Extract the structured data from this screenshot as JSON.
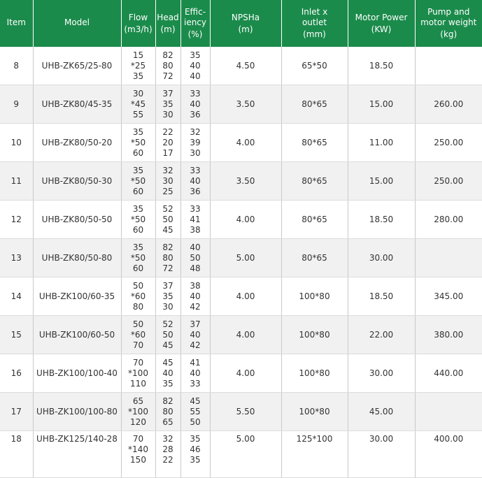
{
  "columns": [
    {
      "label": "Item",
      "sub": ""
    },
    {
      "label": "Model",
      "sub": ""
    },
    {
      "label": "Flow",
      "sub": "(m3/h)"
    },
    {
      "label": "Head",
      "sub": "(m)"
    },
    {
      "label": "Effic-\niency",
      "sub": "(%)"
    },
    {
      "label": "NPSHa",
      "sub": "(m)"
    },
    {
      "label": "Inlet x\noutlet",
      "sub": "(mm)"
    },
    {
      "label": "Motor Power",
      "sub": "(KW)"
    },
    {
      "label": "Pump and\nmotor weight",
      "sub": "(kg)"
    }
  ],
  "rows": [
    {
      "item": "8",
      "model": "UHB-ZK65/25-80",
      "flow": [
        "15",
        "*25",
        "35"
      ],
      "head": [
        "82",
        "80",
        "72"
      ],
      "eff": [
        "35",
        "40",
        "40"
      ],
      "npsha": "4.50",
      "inlet": "65*50",
      "power": "18.50",
      "weight": ""
    },
    {
      "item": "9",
      "model": "UHB-ZK80/45-35",
      "flow": [
        "30",
        "*45",
        "55"
      ],
      "head": [
        "37",
        "35",
        "30"
      ],
      "eff": [
        "33",
        "40",
        "36"
      ],
      "npsha": "3.50",
      "inlet": "80*65",
      "power": "15.00",
      "weight": "260.00"
    },
    {
      "item": "10",
      "model": "UHB-ZK80/50-20",
      "flow": [
        "35",
        "*50",
        "60"
      ],
      "head": [
        "22",
        "20",
        "17"
      ],
      "eff": [
        "32",
        "39",
        "30"
      ],
      "npsha": "4.00",
      "inlet": "80*65",
      "power": "11.00",
      "weight": "250.00"
    },
    {
      "item": "11",
      "model": "UHB-ZK80/50-30",
      "flow": [
        "35",
        "*50",
        "60"
      ],
      "head": [
        "32",
        "30",
        "25"
      ],
      "eff": [
        "33",
        "40",
        "36"
      ],
      "npsha": "3.50",
      "inlet": "80*65",
      "power": "15.00",
      "weight": "250.00"
    },
    {
      "item": "12",
      "model": "UHB-ZK80/50-50",
      "flow": [
        "35",
        "*50",
        "60"
      ],
      "head": [
        "52",
        "50",
        "45"
      ],
      "eff": [
        "33",
        "41",
        "38"
      ],
      "npsha": "4.00",
      "inlet": "80*65",
      "power": "18.50",
      "weight": "280.00"
    },
    {
      "item": "13",
      "model": "UHB-ZK80/50-80",
      "flow": [
        "35",
        "*50",
        "60"
      ],
      "head": [
        "82",
        "80",
        "72"
      ],
      "eff": [
        "40",
        "50",
        "48"
      ],
      "npsha": "5.00",
      "inlet": "80*65",
      "power": "30.00",
      "weight": ""
    },
    {
      "item": "14",
      "model": "UHB-ZK100/60-35",
      "flow": [
        "50",
        "*60",
        "80"
      ],
      "head": [
        "37",
        "35",
        "30"
      ],
      "eff": [
        "38",
        "40",
        "42"
      ],
      "npsha": "4.00",
      "inlet": "100*80",
      "power": "18.50",
      "weight": "345.00"
    },
    {
      "item": "15",
      "model": "UHB-ZK100/60-50",
      "flow": [
        "50",
        "*60",
        "70"
      ],
      "head": [
        "52",
        "50",
        "45"
      ],
      "eff": [
        "37",
        "40",
        "42"
      ],
      "npsha": "4.00",
      "inlet": "100*80",
      "power": "22.00",
      "weight": "380.00"
    },
    {
      "item": "16",
      "model": "UHB-ZK100/100-40",
      "flow": [
        "70",
        "*100",
        "110"
      ],
      "head": [
        "45",
        "40",
        "35"
      ],
      "eff": [
        "41",
        "40",
        "33"
      ],
      "npsha": "4.00",
      "inlet": "100*80",
      "power": "30.00",
      "weight": "440.00"
    },
    {
      "item": "17",
      "model": "UHB-ZK100/100-80",
      "flow": [
        "65",
        "*100",
        "120"
      ],
      "head": [
        "82",
        "80",
        "65"
      ],
      "eff": [
        "45",
        "55",
        "50"
      ],
      "npsha": "5.50",
      "inlet": "100*80",
      "power": "45.00",
      "weight": ""
    },
    {
      "item": "18",
      "model": "UHB-ZK125/140-28",
      "flow": [
        "70",
        "*140",
        "150"
      ],
      "head": [
        "32",
        "28",
        "22"
      ],
      "eff": [
        "35",
        "46",
        "35"
      ],
      "npsha": "5.00",
      "inlet": "125*100",
      "power": "30.00",
      "weight": "400.00"
    }
  ]
}
